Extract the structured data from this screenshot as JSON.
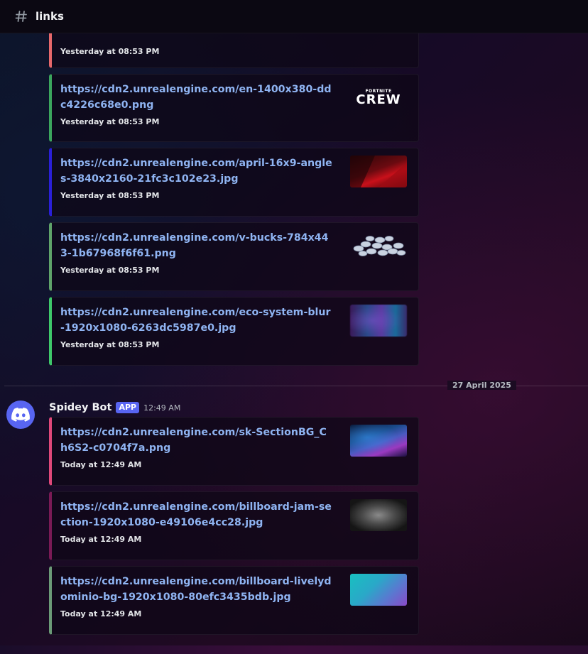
{
  "channel": {
    "name": "links",
    "icon": "hash-icon"
  },
  "top_partial_embed": {
    "time": "Yesterday at 08:53 PM",
    "accent": "#e6686b"
  },
  "embeds_yesterday": [
    {
      "url": "https://cdn2.unrealengine.com/en-1400x380-ddc4226c68e0.png",
      "time": "Yesterday at 08:53 PM",
      "accent": "#3ba55d",
      "thumb": "crew-logo",
      "thumb_text_small": "FORTNITE",
      "thumb_text_big": "CREW"
    },
    {
      "url": "https://cdn2.unrealengine.com/april-16x9-angles-3840x2160-21fc3c102e23.jpg",
      "time": "Yesterday at 08:53 PM",
      "accent": "#2a1fd8",
      "thumb": "red-angles-image"
    },
    {
      "url": "https://cdn2.unrealengine.com/v-bucks-784x443-1b67968f6f61.png",
      "time": "Yesterday at 08:53 PM",
      "accent": "#5fa36a",
      "thumb": "vbucks-coins-image"
    },
    {
      "url": "https://cdn2.unrealengine.com/eco-system-blur-1920x1080-6263dc5987e0.jpg",
      "time": "Yesterday at 08:53 PM",
      "accent": "#3ec86a",
      "thumb": "blur-image"
    }
  ],
  "date_divider": "27 April 2025",
  "message": {
    "author": "Spidey Bot",
    "badge": "APP",
    "time": "12:49 AM",
    "avatar_color": "#5865f2"
  },
  "embeds_today": [
    {
      "url": "https://cdn2.unrealengine.com/sk-SectionBG_Ch6S2-c0704f7a.png",
      "time": "Today at 12:49 AM",
      "accent": "#e0487a",
      "thumb": "blue-purple-bg-image"
    },
    {
      "url": "https://cdn2.unrealengine.com/billboard-jam-section-1920x1080-e49106e4cc28.jpg",
      "time": "Today at 12:49 AM",
      "accent": "#7a1a55",
      "thumb": "gray-blur-image"
    },
    {
      "url": "https://cdn2.unrealengine.com/billboard-livelydominio-bg-1920x1080-80efc3435bdb.jpg",
      "time": "Today at 12:49 AM",
      "accent": "#6b9a77",
      "thumb": "teal-purple-image"
    }
  ]
}
